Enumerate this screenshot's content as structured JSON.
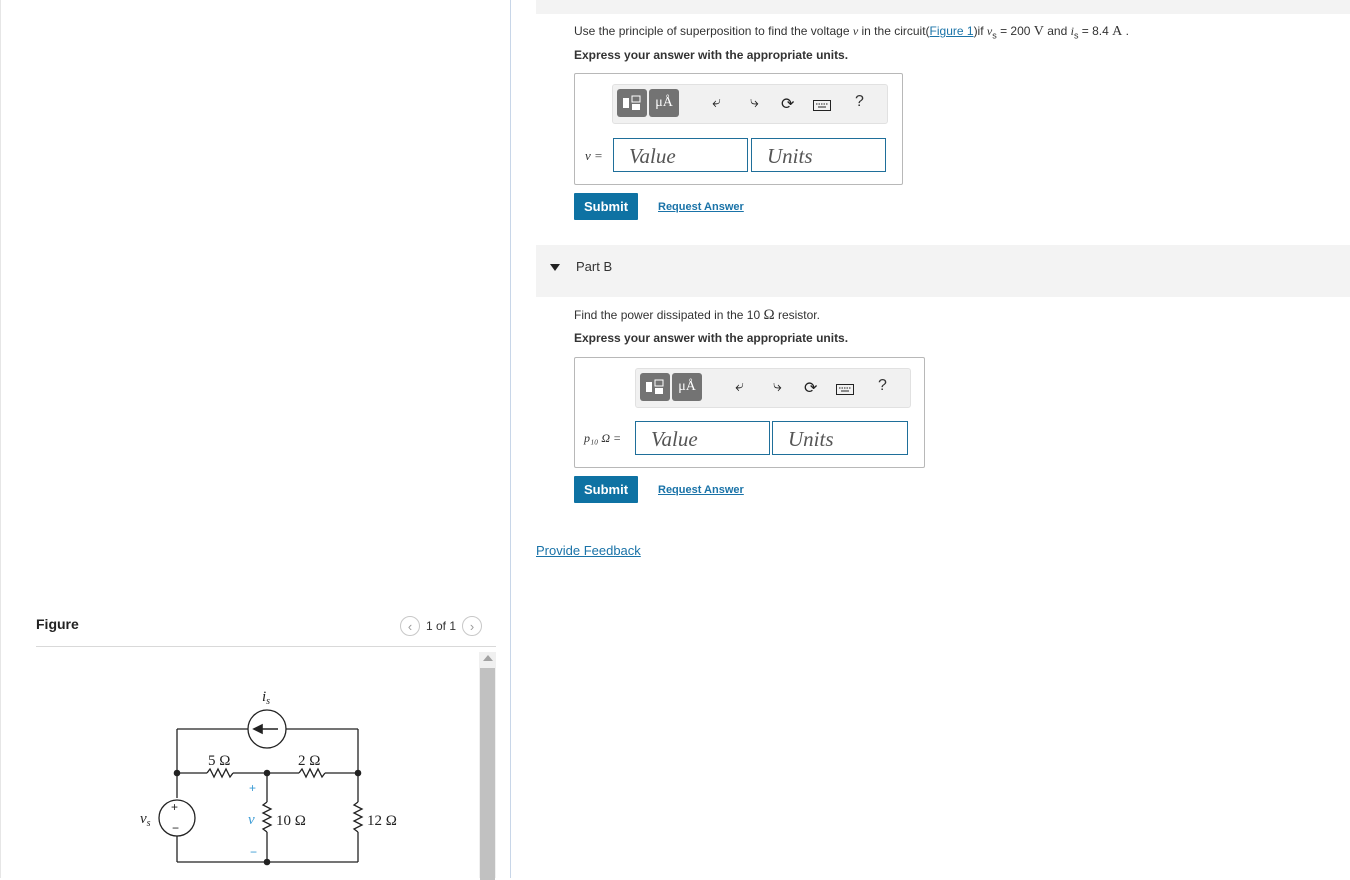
{
  "figure": {
    "title": "Figure",
    "pagination": "1 of 1",
    "circuit_labels": {
      "is": "i",
      "is_sub": "s",
      "vs": "v",
      "vs_sub": "s",
      "r1": "5 Ω",
      "r2": "2 Ω",
      "r3": "10 Ω",
      "r4": "12 Ω",
      "v": "v",
      "plus": "+",
      "minus": "−"
    }
  },
  "part_a": {
    "question_prefix": "Use the principle of superposition to find the voltage ",
    "question_var": "v",
    "question_mid": " in the circuit(",
    "figure_link": "Figure 1",
    "question_if": ")if ",
    "vs_var": "v",
    "vs_sub": "s",
    "vs_eq": " = 200 ",
    "vs_unit": "V",
    "and": " and ",
    "is_var": "i",
    "is_sub": "s",
    "is_eq": " = 8.4 ",
    "is_unit": "A",
    "end": " .",
    "instruction": "Express your answer with the appropriate units.",
    "var_label": "v =",
    "value_placeholder": "Value",
    "units_placeholder": "Units",
    "submit_label": "Submit",
    "request_label": "Request Answer"
  },
  "part_b": {
    "title": "Part B",
    "question_prefix": "Find the power dissipated in the 10 ",
    "omega": "Ω",
    "question_suffix": " resistor.",
    "instruction": "Express your answer with the appropriate units.",
    "var_label": "p₁₀ Ω =",
    "value_placeholder": "Value",
    "units_placeholder": "Units",
    "submit_label": "Submit",
    "request_label": "Request Answer"
  },
  "toolbar": {
    "units_label": "μÅ",
    "help_label": "?",
    "icons": [
      "templates-icon",
      "units-icon",
      "undo-icon",
      "redo-icon",
      "reset-icon",
      "keyboard-icon",
      "help-icon"
    ]
  },
  "feedback_label": "Provide Feedback",
  "colors": {
    "accent": "#0e72a3",
    "link": "#1a73a8",
    "toolbar_button": "#737373"
  }
}
